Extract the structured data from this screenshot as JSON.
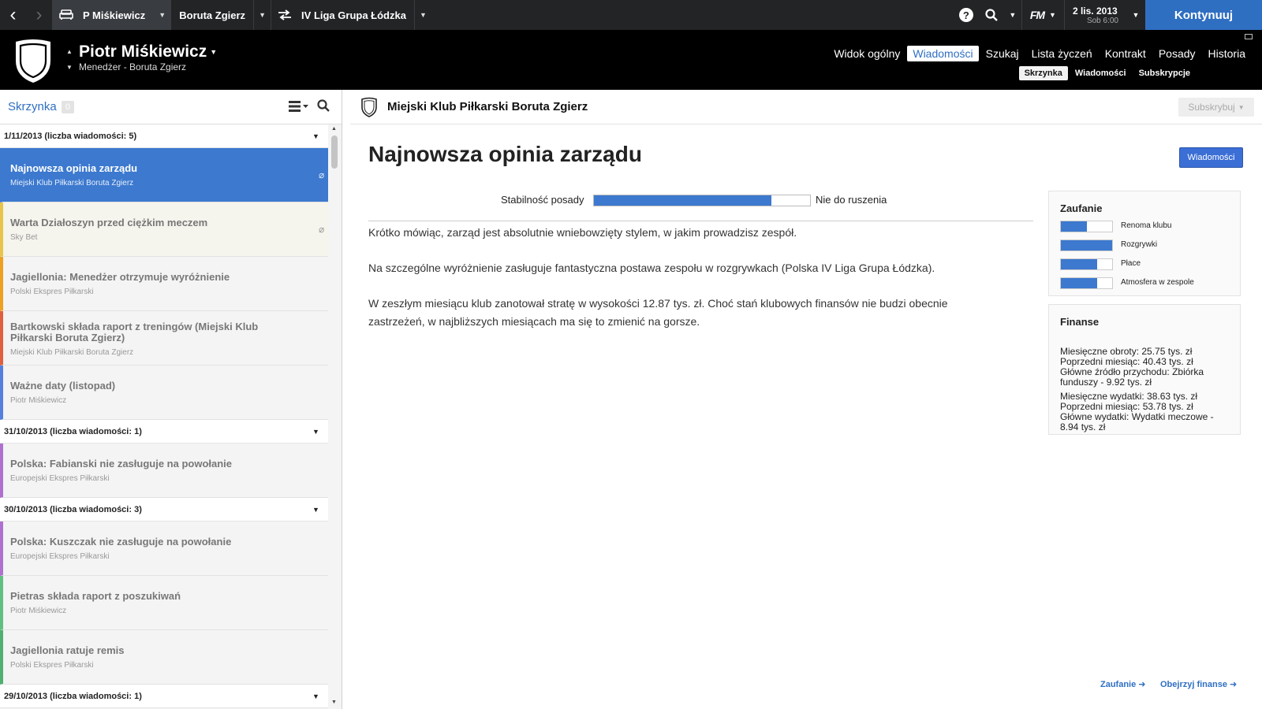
{
  "topbar": {
    "profile": "P Miśkiewicz",
    "club": "Boruta Zgierz",
    "competition": "IV Liga Grupa Łódzka",
    "fm_logo": "FM",
    "date": "2 lis. 2013",
    "time": "Sob 6:00",
    "continue": "Kontynuuj"
  },
  "header": {
    "manager_name": "Piotr Miśkiewicz",
    "manager_role": "Menedżer - Boruta Zgierz",
    "nav": [
      "Widok ogólny",
      "Wiadomości",
      "Szukaj",
      "Lista życzeń",
      "Kontrakt",
      "Posady",
      "Historia"
    ],
    "subnav": [
      "Skrzynka",
      "Wiadomości",
      "Subskrypcje"
    ]
  },
  "inbox": {
    "title": "Skrzynka",
    "count": "0",
    "groups": [
      {
        "label": "1/11/2013 (liczba wiadomości: 5)",
        "items": [
          {
            "title": "Najnowsza opinia zarządu",
            "source": "Miejski Klub Piłkarski Boruta Zgierz",
            "color": "#3c79cf"
          },
          {
            "title": "Warta Działoszyn przed ciężkim meczem",
            "source": "Sky Bet",
            "color": "#e8c44a"
          },
          {
            "title": "Jagiellonia: Menedżer otrzymuje wyróżnienie",
            "source": "Polski Ekspres Piłkarski",
            "color": "#f0a020"
          },
          {
            "title": "Bartkowski składa raport z treningów (Miejski Klub Piłkarski Boruta Zgierz)",
            "source": "Miejski Klub Piłkarski Boruta Zgierz",
            "color": "#e06040"
          },
          {
            "title": "Ważne daty (listopad)",
            "source": "Piotr Miśkiewicz",
            "color": "#5580e0"
          }
        ]
      },
      {
        "label": "31/10/2013 (liczba wiadomości: 1)",
        "items": [
          {
            "title": "Polska: Fabianski nie zasługuje na powołanie",
            "source": "Europejski Ekspres Piłkarski",
            "color": "#b070d0"
          }
        ]
      },
      {
        "label": "30/10/2013 (liczba wiadomości: 3)",
        "items": [
          {
            "title": "Polska: Kuszczak nie zasługuje na powołanie",
            "source": "Europejski Ekspres Piłkarski",
            "color": "#b070d0"
          },
          {
            "title": "Pietras składa raport z poszukiwań",
            "source": "Piotr Miśkiewicz",
            "color": "#60c080"
          },
          {
            "title": "Jagiellonia ratuje remis",
            "source": "Polski Ekspres Piłkarski",
            "color": "#50b070"
          }
        ]
      },
      {
        "label": "29/10/2013 (liczba wiadomości: 1)",
        "items": []
      }
    ]
  },
  "message": {
    "sender": "Miejski Klub Piłkarski Boruta Zgierz",
    "subscribe": "Subskrybuj",
    "title": "Najnowsza opinia zarządu",
    "news_button": "Wiadomości",
    "stability_label": "Stabilność posady",
    "stability_value_label": "Nie do ruszenia",
    "stability_level": 0.82,
    "paragraphs": [
      "Krótko mówiąc, zarząd jest absolutnie wniebowzięty stylem, w jakim prowadzisz zespół.",
      "Na szczególne wyróżnienie zasługuje fantastyczna postawa zespołu w rozgrywkach (Polska IV Liga Grupa Łódzka).",
      "W zeszłym miesiącu klub zanotował stratę w wysokości 12.87 tys. zł. Choć stań klubowych finansów nie budzi obecnie zastrzeżeń, w najbliższych miesiącach ma się to zmienić na gorsze."
    ]
  },
  "confidence": {
    "title": "Zaufanie",
    "items": [
      {
        "label": "Renoma klubu",
        "level": 0.5
      },
      {
        "label": "Rozgrywki",
        "level": 1.0
      },
      {
        "label": "Płace",
        "level": 0.7
      },
      {
        "label": "Atmosfera w zespole",
        "level": 0.7
      }
    ]
  },
  "finances": {
    "title": "Finanse",
    "income": [
      "Miesięczne obroty: 25.75 tys. zł",
      "Poprzedni miesiąc: 40.43 tys. zł",
      "Główne źródło przychodu: Zbiórka funduszy - 9.92 tys. zł"
    ],
    "expenses": [
      "Miesięczne wydatki: 38.63 tys. zł",
      "Poprzedni miesiąc: 53.78 tys. zł",
      "Główne wydatki: Wydatki meczowe - 8.94 tys. zł"
    ]
  },
  "footer_links": {
    "confidence": "Zaufanie ➜",
    "finances": "Obejrzyj finanse ➜"
  }
}
